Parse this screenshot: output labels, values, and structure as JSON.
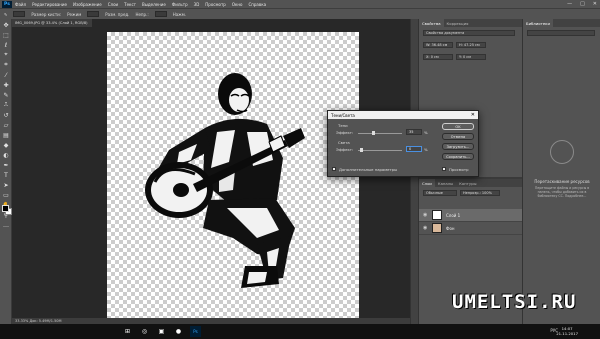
{
  "app": {
    "logo": "Ps",
    "window_controls": [
      "—",
      "□",
      "✕"
    ]
  },
  "menu": {
    "items": [
      "Файл",
      "Редактирование",
      "Изображение",
      "Слои",
      "Текст",
      "Выделение",
      "Фильтр",
      "3D",
      "Просмотр",
      "Окно",
      "Справка"
    ]
  },
  "options_bar": {
    "label_1": "Размер кисти:",
    "label_2": "Режим",
    "label_3": "Разм. пред.",
    "label_4": "Непр.:",
    "label_5": "Нажм."
  },
  "document": {
    "tab_title": "IMG_0069.JPG @ 33.4% (Слой 1, RGB/8)",
    "status": "33.33%   Док: 5.49M/1.50M"
  },
  "properties_panel": {
    "tabs": [
      "Свойства",
      "Коррекция"
    ],
    "header": "Свойства документа",
    "fields": [
      "W: 36.48 см",
      "H: 47.25 см",
      "X: 0 см",
      "Y: 0 см"
    ]
  },
  "layers_panel": {
    "tabs": [
      "Слои",
      "Каналы",
      "Контуры"
    ],
    "blend_mode": "Обычные",
    "opacity_label": "Непрозр.: 100%",
    "layers": [
      {
        "name": "Слой 1",
        "selected": true
      },
      {
        "name": "Фон",
        "selected": false
      }
    ]
  },
  "library_panel": {
    "tab": "Библиотеки",
    "title": "Перетаскивание ресурсов",
    "text": "Перетащите файлы и ресурсы в панель, чтобы добавить их в библиотеку CC. Подробнее..."
  },
  "dialog": {
    "title": "Тени/Света",
    "shadows_label": "Тени",
    "shadows_amount_label": "Эффект:",
    "shadows_value": "35",
    "highlights_label": "Света",
    "highlights_amount_label": "Эффект:",
    "highlights_value": "0",
    "percent": "%",
    "buttons": [
      "OK",
      "Отмена",
      "Загрузить...",
      "Сохранить..."
    ],
    "preview_label": "Просмотр",
    "more_options_label": "Дополнительные параметры"
  },
  "taskbar": {
    "lang": "РУС",
    "time": "14:07",
    "date": "21.11.2017"
  },
  "watermark": "UMELTSI.RU"
}
